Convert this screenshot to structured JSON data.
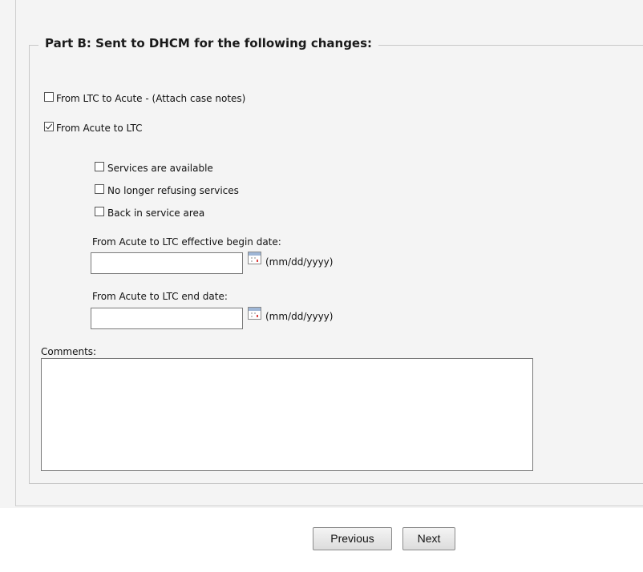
{
  "section": {
    "title": "Part B: Sent to DHCM for the following changes:"
  },
  "options": {
    "ltc_to_acute": {
      "label": "From LTC to Acute - (Attach case notes)",
      "checked": false
    },
    "acute_to_ltc": {
      "label": "From Acute to LTC",
      "checked": true
    }
  },
  "sub_options": [
    {
      "label": "Services are available",
      "checked": false
    },
    {
      "label": "No longer refusing services",
      "checked": false
    },
    {
      "label": "Back in service area",
      "checked": false
    }
  ],
  "begin_date": {
    "label": "From Acute to LTC effective begin date:",
    "value": "",
    "format_hint": "(mm/dd/yyyy)"
  },
  "end_date": {
    "label": "From Acute to LTC end date:",
    "value": "",
    "format_hint": "(mm/dd/yyyy)"
  },
  "comments": {
    "label": "Comments:",
    "value": ""
  },
  "buttons": {
    "previous": "Previous",
    "next": "Next"
  },
  "icons": {
    "calendar": "calendar-icon",
    "scroll_up": "chevron-up-icon",
    "scroll_down": "chevron-down-icon"
  }
}
